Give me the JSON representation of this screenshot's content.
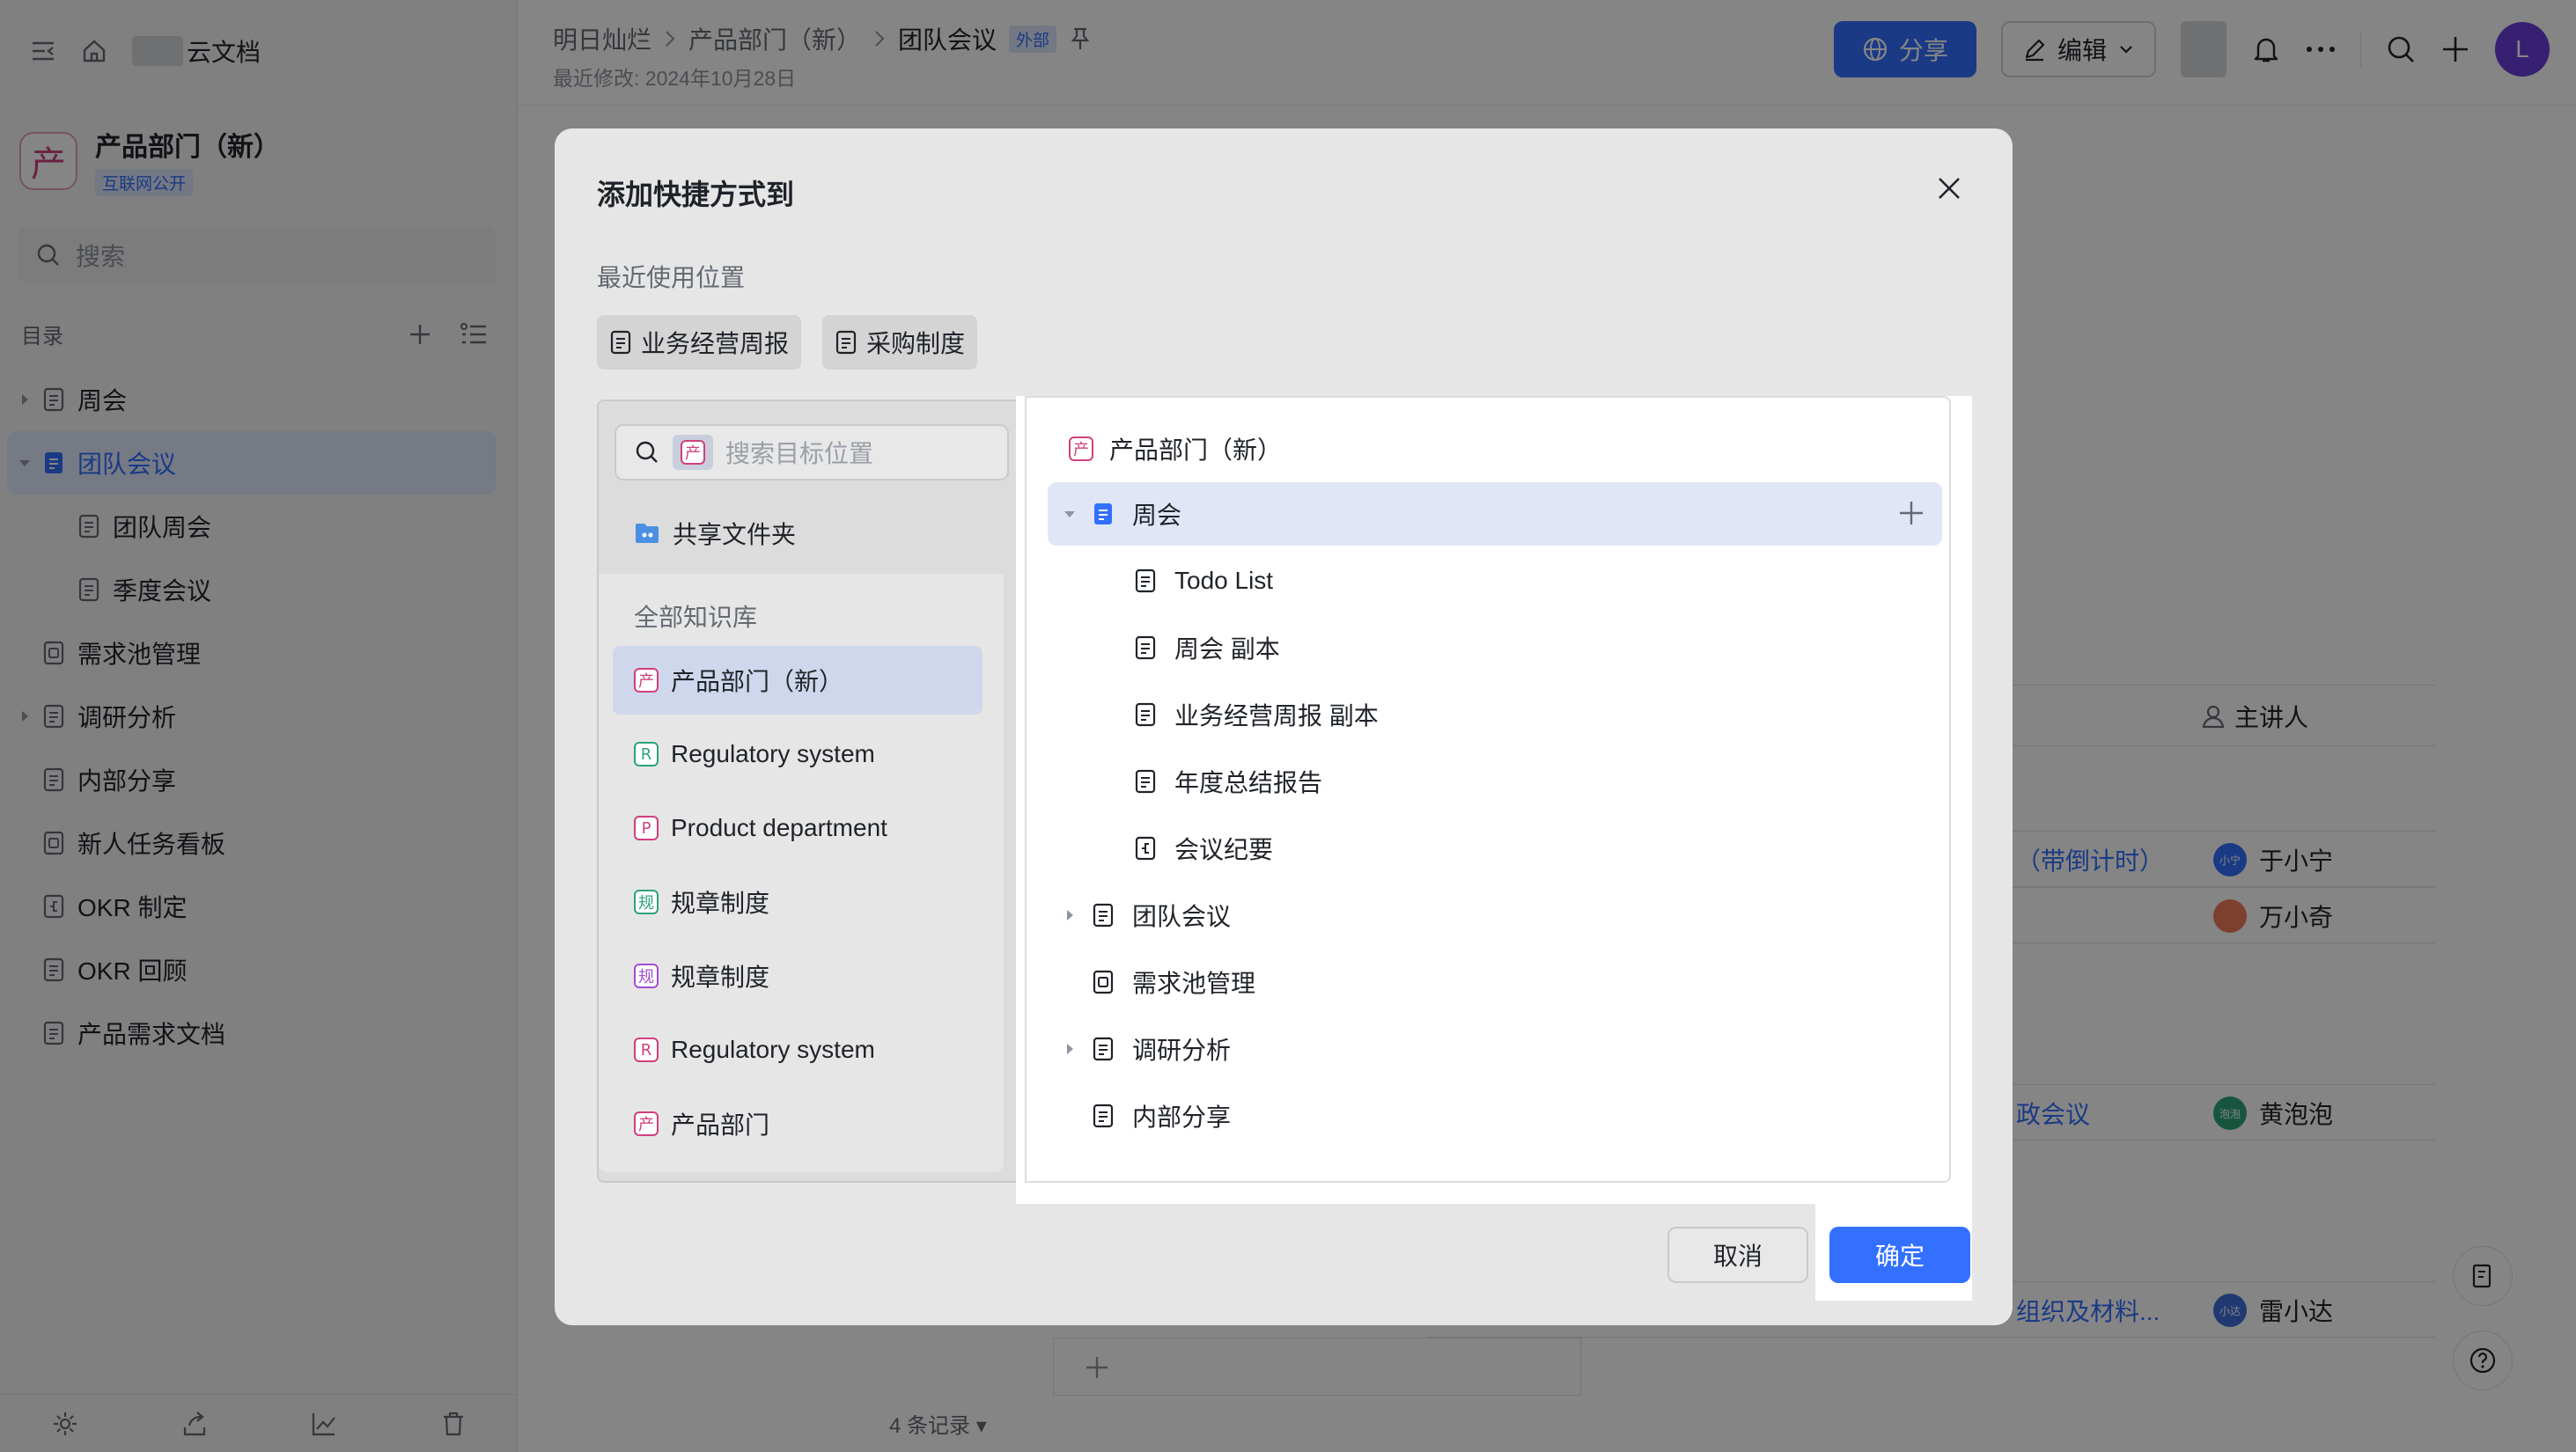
{
  "sidebar": {
    "brand": "云文档",
    "space_name": "产品部门（新）",
    "space_tag": "互联网公开",
    "space_logo_char": "产",
    "search_placeholder": "搜索",
    "toc_label": "目录",
    "tree": [
      {
        "label": "周会",
        "caret": true,
        "indent": 0,
        "icon": "doc-icon"
      },
      {
        "label": "团队会议",
        "caret": true,
        "expanded": true,
        "indent": 0,
        "icon": "doc-icon",
        "active": true
      },
      {
        "label": "团队周会",
        "indent": 1,
        "icon": "doc-icon"
      },
      {
        "label": "季度会议",
        "indent": 1,
        "icon": "doc-icon"
      },
      {
        "label": "需求池管理",
        "indent": 0,
        "icon": "board-icon"
      },
      {
        "label": "调研分析",
        "caret": true,
        "indent": 0,
        "icon": "doc-icon"
      },
      {
        "label": "内部分享",
        "indent": 0,
        "icon": "doc-icon"
      },
      {
        "label": "新人任务看板",
        "indent": 0,
        "icon": "board-icon"
      },
      {
        "label": "OKR 制定",
        "indent": 0,
        "icon": "mindmap-icon"
      },
      {
        "label": "OKR 回顾",
        "indent": 0,
        "icon": "doc-icon"
      },
      {
        "label": "产品需求文档",
        "indent": 0,
        "icon": "doc-icon"
      }
    ]
  },
  "header": {
    "breadcrumbs": [
      "明日灿烂",
      "产品部门（新）",
      "团队会议"
    ],
    "external_tag": "外部",
    "last_modified": "最近修改: 2024年10月28日",
    "share_label": "分享",
    "edit_label": "编辑",
    "avatar_letter": "L"
  },
  "background_table": {
    "column_presenter": "主讲人",
    "rows": [
      {
        "task": "（带倒计时）",
        "presenter": "于小宁",
        "avatar_text": "小宁",
        "avatar_color": "#3370ff"
      },
      {
        "task": "",
        "presenter": "万小奇",
        "avatar_text": "",
        "avatar_color": "#f07b5a"
      },
      {
        "task": "政会议",
        "presenter": "黄泡泡",
        "avatar_text": "泡泡",
        "avatar_color": "#2ea37a"
      },
      {
        "task": "组织及材料...",
        "presenter": "雷小达",
        "avatar_text": "小达",
        "avatar_color": "#3f6fd8"
      }
    ],
    "records_label": "4 条记录"
  },
  "modal": {
    "title": "添加快捷方式到",
    "recent_label": "最近使用位置",
    "recent": [
      "业务经营周报",
      "采购制度"
    ],
    "search_placeholder": "搜索目标位置",
    "search_badge_char": "产",
    "shared_folder": "共享文件夹",
    "all_kb_label": "全部知识库",
    "knowledge_bases": [
      {
        "label": "产品部门（新）",
        "badge": "产",
        "color": "#d0407d",
        "selected": true
      },
      {
        "label": "Regulatory system",
        "badge": "R",
        "color": "#2ea37a"
      },
      {
        "label": "Product department",
        "badge": "P",
        "color": "#d0407d"
      },
      {
        "label": "规章制度",
        "badge": "规",
        "color": "#2ea37a"
      },
      {
        "label": "规章制度",
        "badge": "规",
        "color": "#a04fd0"
      },
      {
        "label": "Regulatory system",
        "badge": "R",
        "color": "#d0407d"
      },
      {
        "label": "产品部门",
        "badge": "产",
        "color": "#d0407d"
      }
    ],
    "tree_root": "产品部门（新）",
    "tree": [
      {
        "label": "周会",
        "caret": "down",
        "indent": 0,
        "icon": "doc-icon",
        "highlight": true,
        "filled": true
      },
      {
        "label": "Todo List",
        "indent": 1,
        "icon": "doc-icon"
      },
      {
        "label": "周会 副本",
        "indent": 1,
        "icon": "doc-icon"
      },
      {
        "label": "业务经营周报 副本",
        "indent": 1,
        "icon": "doc-icon"
      },
      {
        "label": "年度总结报告",
        "indent": 1,
        "icon": "doc-icon"
      },
      {
        "label": "会议纪要",
        "indent": 1,
        "icon": "mindmap-icon"
      },
      {
        "label": "团队会议",
        "caret": "right",
        "indent": 0,
        "icon": "doc-icon"
      },
      {
        "label": "需求池管理",
        "indent": 0,
        "icon": "board-icon"
      },
      {
        "label": "调研分析",
        "caret": "right",
        "indent": 0,
        "icon": "doc-icon"
      },
      {
        "label": "内部分享",
        "indent": 0,
        "icon": "doc-icon"
      }
    ],
    "cancel_label": "取消",
    "confirm_label": "确定"
  },
  "colors": {
    "accent": "#3370ff",
    "highlight": "#e1e6f6",
    "brand_pink": "#d0407d"
  }
}
